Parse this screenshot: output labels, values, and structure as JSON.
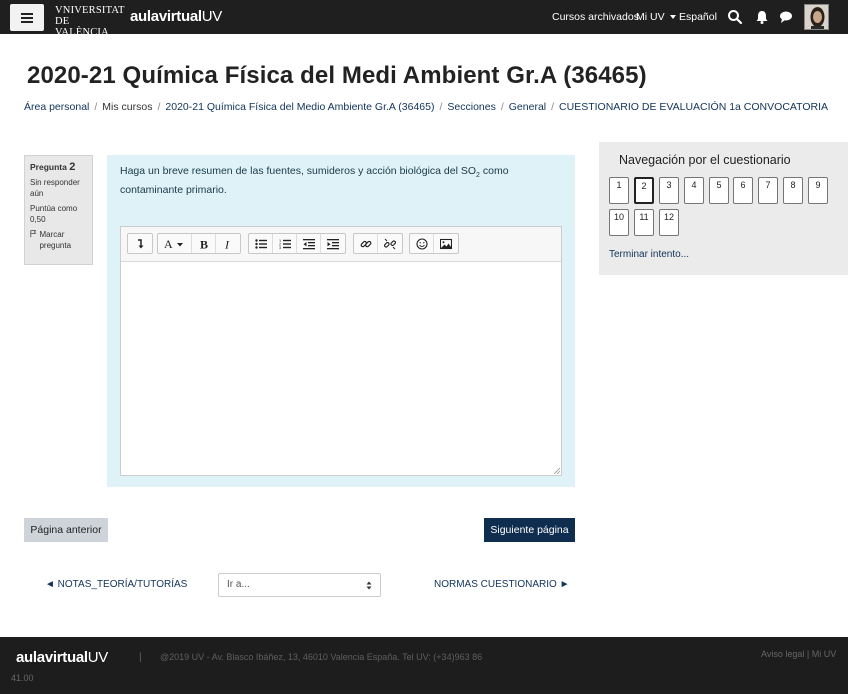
{
  "navbar": {
    "menu_icon": "hamburger-icon",
    "uv_logo_line1": "VNIVERSITAT",
    "uv_logo_line2": "DE VALÈNCIA",
    "aulavirtual_bold": "aulavirtual",
    "aulavirtual_uv": "UV",
    "archived_courses": "Cursos archivados",
    "mi_uv": "Mi UV",
    "language": "Español",
    "icons": [
      "search-icon",
      "bell-icon",
      "chat-icon"
    ],
    "avatar_icon": "user-avatar"
  },
  "header": {
    "title": "2020-21 Química Física del Medi Ambient Gr.A (36465)",
    "breadcrumb": [
      "Área personal",
      "Mis cursos",
      "2020-21 Química Física del Medio Ambiente Gr.A (36465)",
      "Secciones",
      "General",
      "CUESTIONARIO DE EVALUACIÓN 1a CONVOCATORIA"
    ]
  },
  "question": {
    "label": "Pregunta",
    "number": "2",
    "status": "Sin responder aún",
    "score": "Puntúa como 0,50",
    "flag_label": "Marcar pregunta",
    "text_before": "Haga un breve resumen de las fuentes, sumideros y acción biológica del SO",
    "subscript": "2",
    "text_after": " como contaminante primario.",
    "editor_value": ""
  },
  "editor_toolbar": {
    "buttons": [
      "collapse-icon",
      "font-style-icon",
      "bold-icon",
      "italic-icon",
      "unordered-list-icon",
      "ordered-list-icon",
      "outdent-icon",
      "indent-icon",
      "link-icon",
      "unlink-icon",
      "emoji-icon",
      "image-icon"
    ]
  },
  "quiz_nav": {
    "title": "Navegación por el cuestionario",
    "questions": [
      "1",
      "2",
      "3",
      "4",
      "5",
      "6",
      "7",
      "8",
      "9",
      "10",
      "11",
      "12"
    ],
    "current": "2",
    "finish": "Terminar intento..."
  },
  "buttons": {
    "prev_page": "Página anterior",
    "next_page": "Siguiente página"
  },
  "activity_nav": {
    "prev": "◄ NOTAS_TEORÍA/TUTORÍAS",
    "select_placeholder": "Ir a...",
    "next": "NORMAS CUESTIONARIO ►"
  },
  "footer": {
    "logo_bold": "aulavirtual",
    "logo_uv": "UV",
    "separator": "|",
    "address": "@2019 UV - Av. Blasco Ibáñez, 13, 46010 Valencia España. Tel UV: (+34)963 86",
    "links": "Aviso legal | Mi UV",
    "version": "41.00"
  },
  "colors": {
    "navbar_bg": "#1f1f1f",
    "question_bg": "#def2f8",
    "primary_button": "#0f2d4f",
    "link": "#10335a"
  }
}
